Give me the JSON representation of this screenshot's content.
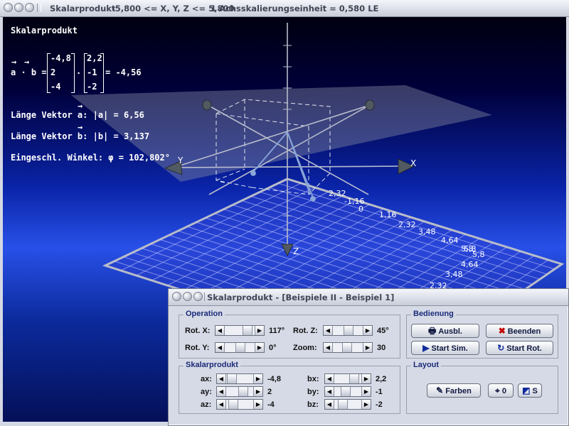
{
  "main_window": {
    "title": "Skalarprodukt",
    "title_range": "-5,800 <= X, Y, Z <= 5,800",
    "title_unit": "1 Achsskalierungseinheit = 0,580 LE"
  },
  "hud": {
    "heading": "Skalarprodukt",
    "arrow": "→",
    "dot_expr_label": "a · b =",
    "vector_a": [
      "-4,8",
      "2",
      "-4"
    ],
    "vector_b": [
      "2,2",
      "-1",
      "-2"
    ],
    "dot_symbol": "·",
    "dot_result": "= -4,56",
    "length_a": "Länge Vektor a: |a| = 6,56",
    "length_b": "Länge Vektor b: |b| = 3,137",
    "angle": "Eingeschl. Winkel: φ = 102,802°"
  },
  "axes": {
    "x_label": "X",
    "y_label": "Y",
    "z_label": "Z",
    "origin_label": "0",
    "ticks_grid_right": [
      "1,16",
      "2,32",
      "3,48",
      "4,64",
      "5,8"
    ],
    "ticks_grid_front": [
      "5,8",
      "4,64",
      "3,48",
      "2,32"
    ],
    "ticks_center": [
      "2,32",
      "-1,16",
      "0"
    ]
  },
  "dialog": {
    "title": "Skalarprodukt - [Beispiele II - Beispiel 1]",
    "operation": {
      "title": "Operation",
      "rot_x_label": "Rot. X:",
      "rot_x_value": "117°",
      "rot_y_label": "Rot. Y:",
      "rot_y_value": "0°",
      "rot_z_label": "Rot. Z:",
      "rot_z_value": "45°",
      "zoom_label": "Zoom:",
      "zoom_value": "30"
    },
    "bedienung": {
      "title": "Bedienung",
      "ausbl": "Ausbl.",
      "beenden": "Beenden",
      "start_sim": "Start Sim.",
      "start_rot": "Start Rot."
    },
    "skalarprodukt": {
      "title": "Skalarprodukt",
      "ax_label": "ax:",
      "ax_value": "-4,8",
      "ay_label": "ay:",
      "ay_value": "2",
      "az_label": "az:",
      "az_value": "-4",
      "bx_label": "bx:",
      "bx_value": "2,2",
      "by_label": "by:",
      "by_value": "-1",
      "bz_label": "bz:",
      "bz_value": "-2"
    },
    "layout": {
      "title": "Layout",
      "farben": "Farben",
      "null": "0",
      "s": "S"
    }
  },
  "colors": {
    "background_top": "#000010",
    "background_mid": "#2850e8",
    "vector_color": "#8aa6d8",
    "group_title": "#1a2a78"
  }
}
